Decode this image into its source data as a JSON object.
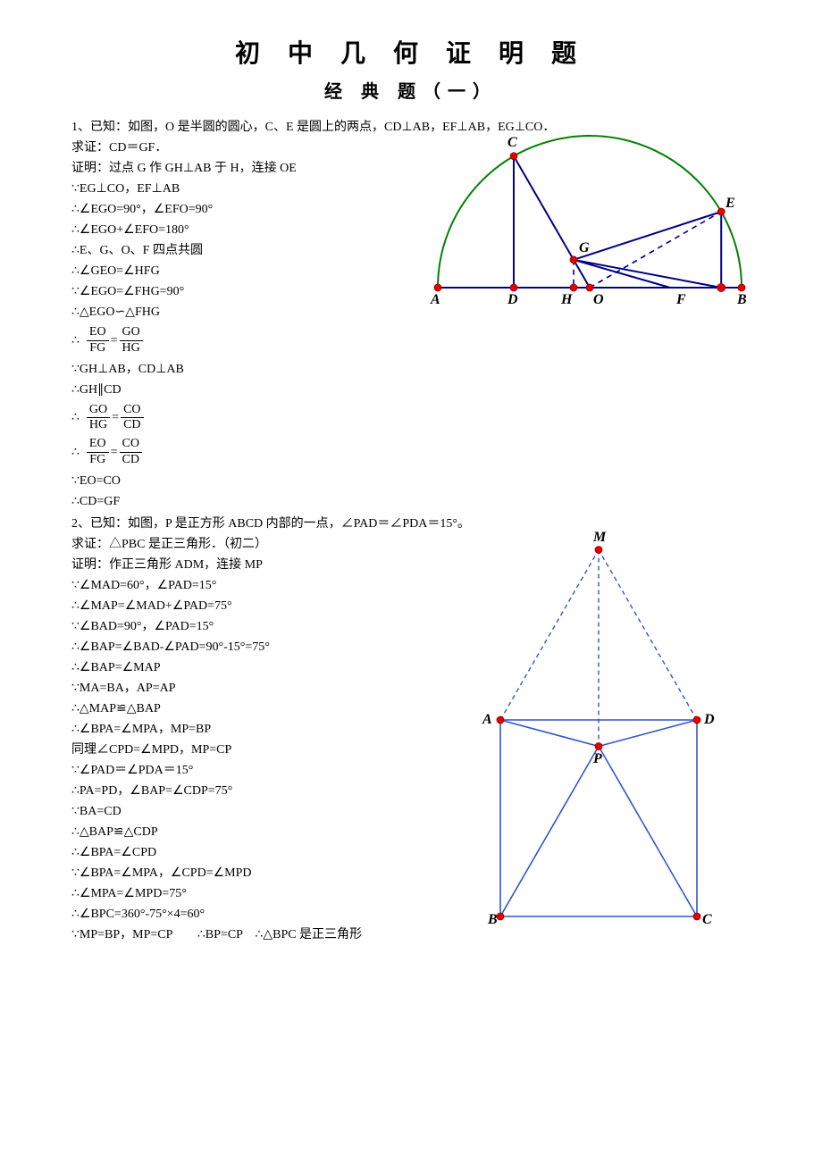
{
  "title": "初 中 几 何 证 明 题",
  "subtitle": "经 典 题（一）",
  "p1": {
    "q1": "1、已知：如图，O 是半圆的圆心，C、E 是圆上的两点，CD⊥AB，EF⊥AB，EG⊥CO．",
    "q2": "求证：CD＝GF．",
    "proof_header": "证明：过点 G 作 GH⊥AB 于 H，连接 OE",
    "lines": [
      "∵EG⊥CO，EF⊥AB",
      "∴∠EGO=90°，∠EFO=90°",
      "∴∠EGO+∠EFO=180°",
      "∴E、G、O、F 四点共圆",
      "∴∠GEO=∠HFG",
      "∵∠EGO=∠FHG=90°",
      "∴△EGO∽△FHG"
    ],
    "frac1": {
      "prefix": "∴",
      "a_num": "EO",
      "a_den": "FG",
      "mid": "=",
      "b_num": "GO",
      "b_den": "HG"
    },
    "lines2": [
      "∵GH⊥AB，CD⊥AB",
      "∴GH∥CD"
    ],
    "frac2": {
      "prefix": "∴",
      "a_num": "GO",
      "a_den": "HG",
      "mid": "=",
      "b_num": "CO",
      "b_den": "CD"
    },
    "frac3": {
      "prefix": "∴",
      "a_num": "EO",
      "a_den": "FG",
      "mid": "=",
      "b_num": "CO",
      "b_den": "CD"
    },
    "lines3": [
      "∵EO=CO",
      "∴CD=GF"
    ]
  },
  "p2": {
    "q1": "2、已知：如图，P 是正方形 ABCD 内部的一点，∠PAD＝∠PDA＝15°。",
    "q2": "求证：△PBC 是正三角形．（初二）",
    "proof_header": "证明：作正三角形 ADM，连接 MP",
    "lines": [
      "∵∠MAD=60°，∠PAD=15°",
      "∴∠MAP=∠MAD+∠PAD=75°",
      "∵∠BAD=90°，∠PAD=15°",
      "∴∠BAP=∠BAD-∠PAD=90°-15°=75°",
      "∴∠BAP=∠MAP",
      "∵MA=BA，AP=AP",
      "∴△MAP≌△BAP",
      "∴∠BPA=∠MPA，MP=BP",
      "同理∠CPD=∠MPD，MP=CP",
      "∵∠PAD＝∠PDA＝15°",
      "∴PA=PD，∠BAP=∠CDP=75°",
      "∵BA=CD",
      "∴△BAP≌△CDP",
      "∴∠BPA=∠CPD",
      "∵∠BPA=∠MPA，∠CPD=∠MPD",
      "∴∠MPA=∠MPD=75°",
      "∴∠BPC=360°-75°×4=60°",
      "∵MP=BP，MP=CP　　∴BP=CP　∴△BPC 是正三角形"
    ]
  },
  "fig1_labels": {
    "A": "A",
    "B": "B",
    "C": "C",
    "D": "D",
    "E": "E",
    "F": "F",
    "G": "G",
    "H": "H",
    "O": "O"
  },
  "fig2_labels": {
    "A": "A",
    "B": "B",
    "C": "C",
    "D": "D",
    "P": "P",
    "M": "M"
  }
}
